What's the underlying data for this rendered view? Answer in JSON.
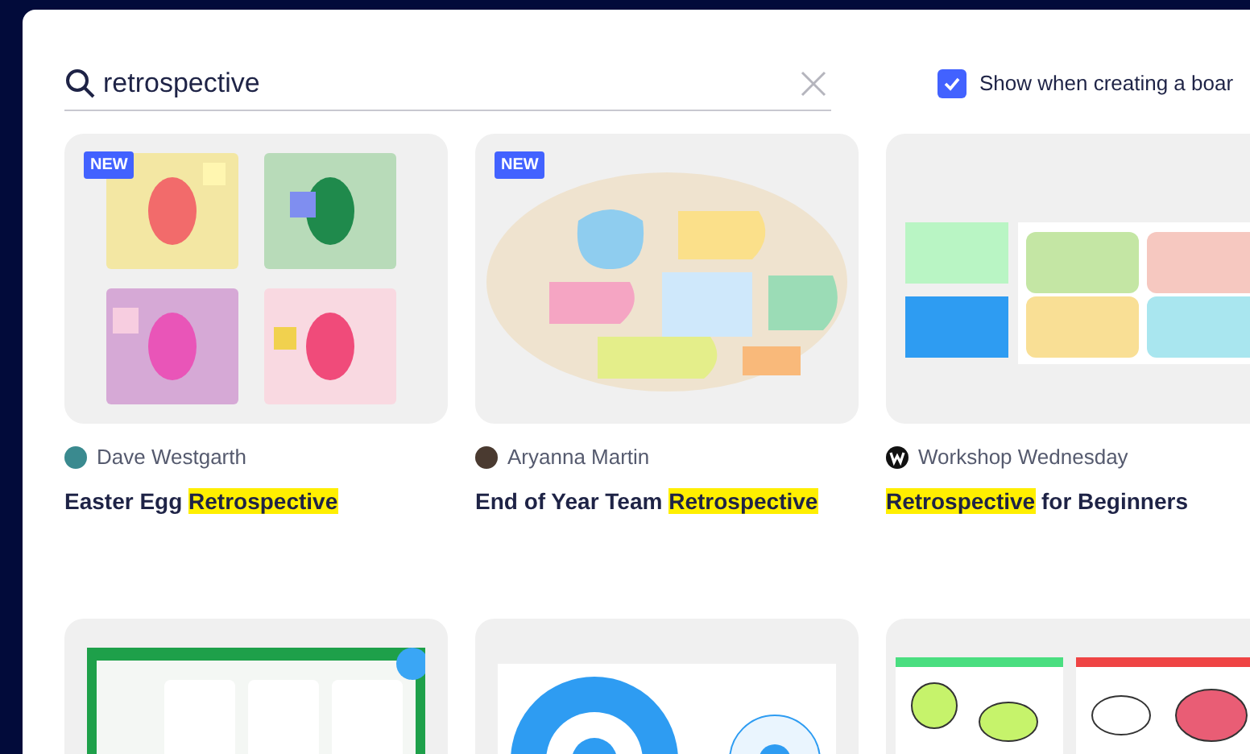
{
  "search": {
    "value": "retrospective"
  },
  "show_when_creating": {
    "label": "Show when creating a boar",
    "checked": true
  },
  "templates": [
    {
      "badge": "NEW",
      "author": "Dave Westgarth",
      "title": [
        {
          "text": "Easter Egg "
        },
        {
          "text": "Retrospective",
          "highlighted": true
        }
      ]
    },
    {
      "badge": "NEW",
      "author": "Aryanna Martin",
      "title": [
        {
          "text": "End of Year Team "
        },
        {
          "text": "Retrospective",
          "highlighted": true
        }
      ]
    },
    {
      "author": "Workshop Wednesday",
      "title": [
        {
          "text": "Retrospective",
          "highlighted": true
        },
        {
          "text": " for Beginners"
        }
      ]
    }
  ]
}
